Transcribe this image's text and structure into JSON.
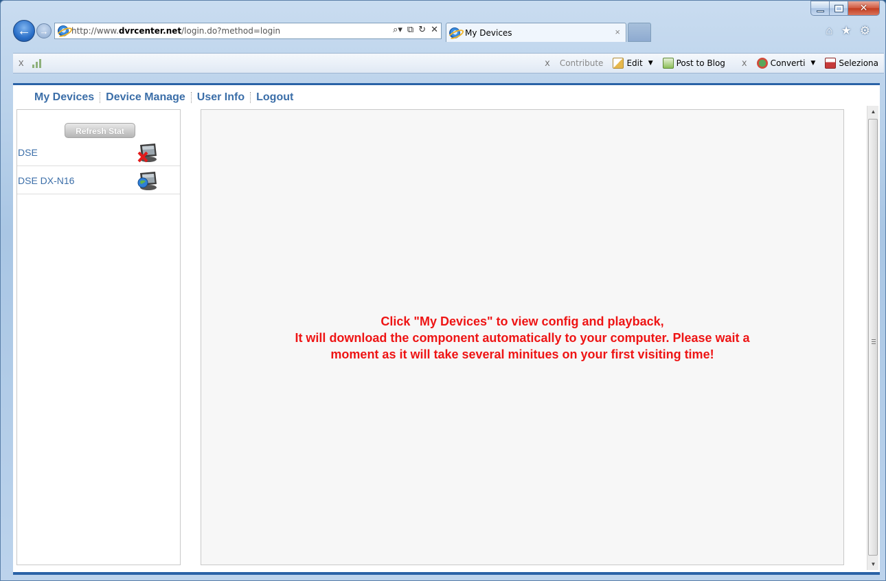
{
  "browser": {
    "url_prefix": "http://www.",
    "url_domain": "dvrcenter.net",
    "url_path": "/login.do?method=login",
    "tab_title": "My Devices",
    "tab_close": "×",
    "addr_tools": [
      "search-icon",
      "compat-icon",
      "refresh-icon",
      "stop-icon"
    ],
    "right_icons": [
      "home-icon",
      "favorites-icon",
      "tools-icon"
    ]
  },
  "toolbar": {
    "close_glyph": "x",
    "contribute_label": "Contribute",
    "edit_label": "Edit",
    "post_to_blog_label": "Post to Blog",
    "converti_label": "Converti",
    "seleziona_label": "Seleziona"
  },
  "nav": {
    "items": [
      {
        "label": "My Devices"
      },
      {
        "label": "Device Manage"
      },
      {
        "label": "User Info"
      },
      {
        "label": "Logout"
      }
    ]
  },
  "sidebar": {
    "refresh_label": "Refresh Stat",
    "devices": [
      {
        "name": "DSE",
        "status": "offline"
      },
      {
        "name": "DSE DX-N16",
        "status": "online"
      }
    ]
  },
  "content": {
    "message_lines": [
      "Click \"My Devices\" to view config and playback,",
      "It will download the component automatically to your computer. Please wait a",
      "moment as it will take several minitues on your first visiting time!"
    ]
  },
  "colors": {
    "link": "#3b6ea8",
    "message": "#ee1414",
    "frame_accent": "#2a62a6"
  }
}
